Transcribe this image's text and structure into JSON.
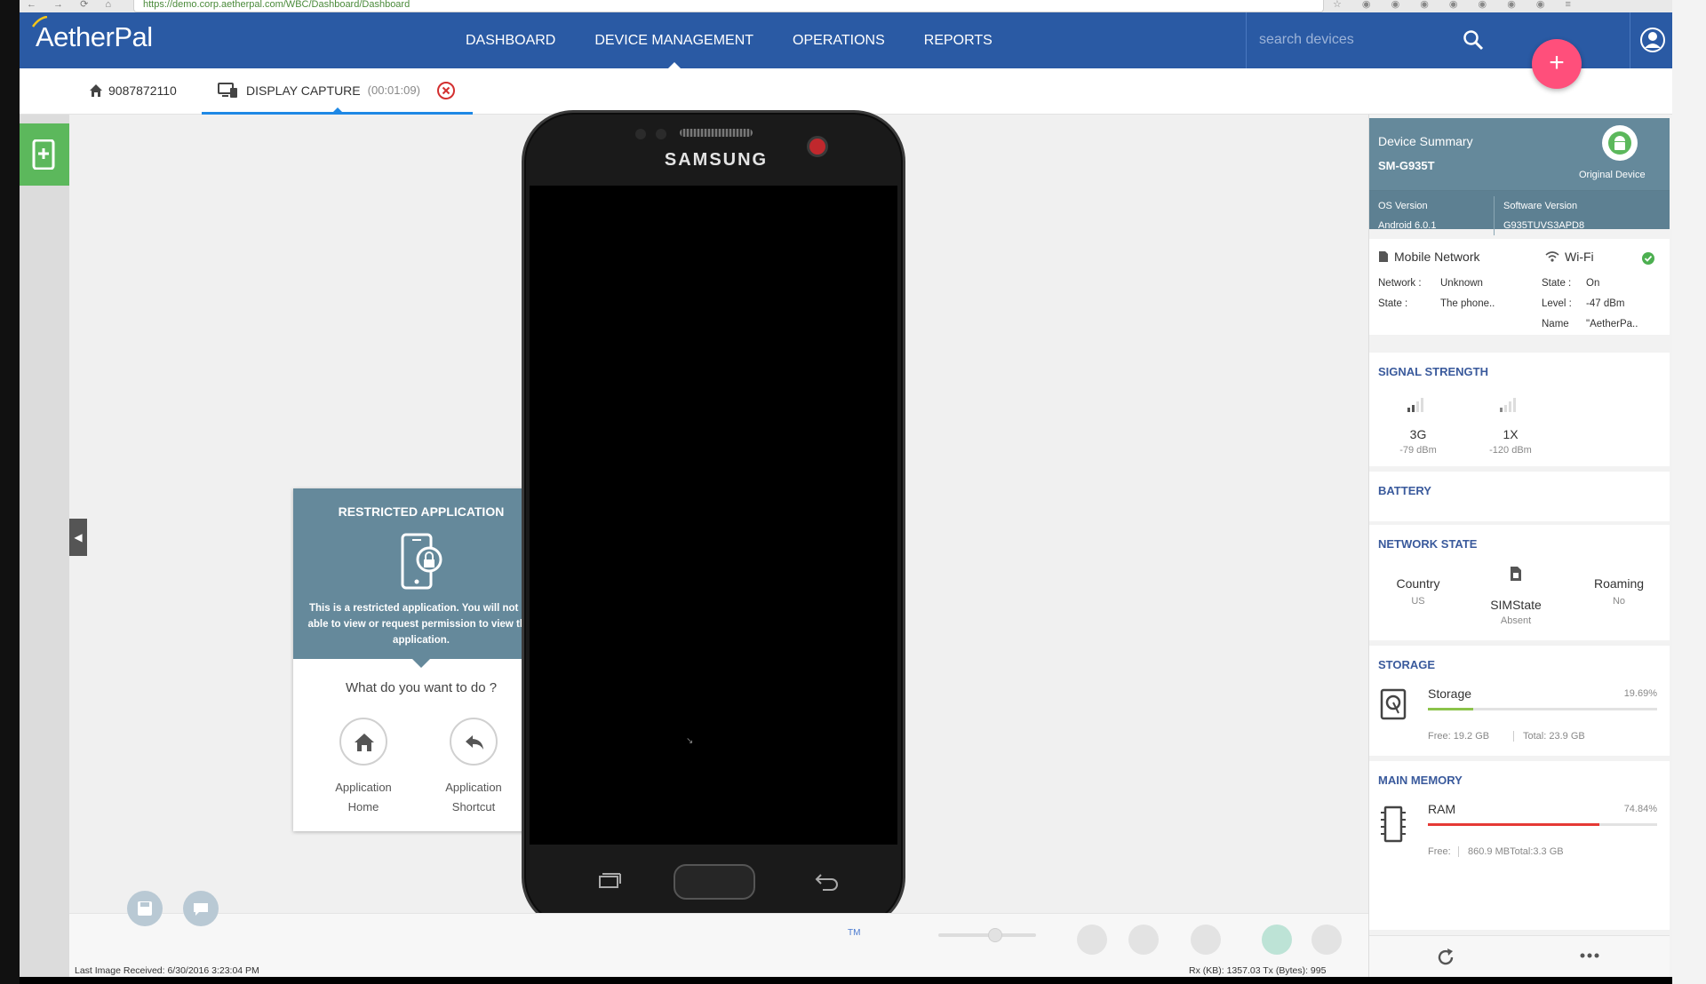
{
  "browser": {
    "url": "https://demo.corp.aetherpal.com/WBC/Dashboard/Dashboard"
  },
  "app": {
    "logo": "AetherPal"
  },
  "nav": {
    "items": [
      {
        "label": "DASHBOARD",
        "active": false
      },
      {
        "label": "DEVICE MANAGEMENT",
        "active": true
      },
      {
        "label": "OPERATIONS",
        "active": false
      },
      {
        "label": "REPORTS",
        "active": false
      }
    ],
    "search_placeholder": "search devices",
    "fab_label": "+"
  },
  "subbar": {
    "device_number": "9087872110",
    "tab_label": "DISPLAY CAPTURE",
    "tab_timer": "(00:01:09)"
  },
  "phone": {
    "brand": "SAMSUNG"
  },
  "restricted": {
    "title": "RESTRICTED APPLICATION",
    "message": "This is a restricted application. You will not be able to view or request permission to view this application.",
    "question": "What do you want to do ?",
    "actions": [
      {
        "line1": "Application",
        "line2": "Home"
      },
      {
        "line1": "Application",
        "line2": "Shortcut"
      }
    ]
  },
  "bottom": {
    "last_image": "Last Image Received: 6/30/2016 3:23:04 PM",
    "traffic": "Rx (KB): 1357.03    Tx (Bytes): 995",
    "tm": "TM"
  },
  "summary": {
    "title": "Device Summary",
    "model": "SM-G935T",
    "original": "Original Device",
    "os_label": "OS Version",
    "os_value": "Android 6.0.1",
    "sw_label": "Software Version",
    "sw_value": "G935TUVS3APD8"
  },
  "network": {
    "mobile_title": "Mobile Network",
    "network_label": "Network :",
    "network_value": "Unknown",
    "state_label": "State :",
    "state_value": "The phone..",
    "wifi_title": "Wi-Fi",
    "wifi_state_label": "State :",
    "wifi_state_value": "On",
    "wifi_level_label": "Level :",
    "wifi_level_value": "-47 dBm",
    "wifi_name_label": "Name",
    "wifi_name_value": "\"AetherPa.."
  },
  "signal": {
    "title": "SIGNAL STRENGTH",
    "items": [
      {
        "label": "3G",
        "value": "-79 dBm"
      },
      {
        "label": "1X",
        "value": "-120 dBm"
      }
    ]
  },
  "battery": {
    "title": "BATTERY"
  },
  "netstate": {
    "title": "NETWORK STATE",
    "country_label": "Country",
    "country_value": "US",
    "sim_label": "SIMState",
    "sim_value": "Absent",
    "roaming_label": "Roaming",
    "roaming_value": "No"
  },
  "storage": {
    "title": "STORAGE",
    "label": "Storage",
    "percent": "19.69%",
    "fill_fraction": 0.1969,
    "free": "Free: 19.2 GB",
    "total": "Total: 23.9 GB",
    "color": "#8bc34a"
  },
  "memory": {
    "title": "MAIN MEMORY",
    "label": "RAM",
    "percent": "74.84%",
    "fill_fraction": 0.7484,
    "free": "Free:",
    "free_value": "860.9 MBTotal:3.3 GB",
    "color": "#e53935"
  },
  "colors": {
    "nav": "#2a5aa4",
    "accent": "#ff4f7b",
    "card_head": "#65899b",
    "rail_green": "#5cb85c"
  },
  "icons": [
    "home-icon",
    "display-capture-icon",
    "close-icon",
    "search-icon",
    "user-icon",
    "android-icon",
    "sim-icon",
    "hard-drive-icon",
    "chip-icon",
    "refresh-icon",
    "more-icon",
    "wifi-icon",
    "phone-lock-icon",
    "shortcut-icon"
  ]
}
